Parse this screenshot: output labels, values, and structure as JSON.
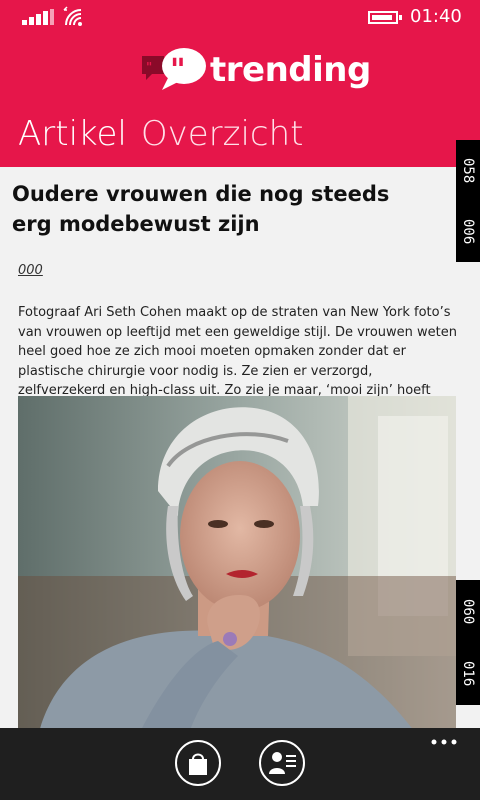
{
  "status": {
    "time": "01:40"
  },
  "header": {
    "logo_text": "trending",
    "tabs": [
      "Artikel",
      "Overzicht"
    ]
  },
  "article": {
    "title": "Oudere vrouwen die nog steeds erg modebewust zijn",
    "meta": "000",
    "body": "Fotograaf Ari Seth Cohen maakt op de straten van New York foto’s van vrouwen op leeftijd met een geweldige stijl. De vrouwen weten heel goed hoe ze zich mooi moeten opmaken zonder dat er plastische chirurgie voor nodig is. Ze zien er verzorgd, zelfverzekerd en high-class uit. Zo zie je maar, ‘mooi zijn’ hoeft niet te verouderen."
  },
  "side_rulers": {
    "top": [
      "058",
      "006"
    ],
    "bottom": [
      "060",
      "016"
    ]
  },
  "colors": {
    "accent": "#e6164a",
    "appbar": "#1f1f1f"
  },
  "icons": {
    "appbar": [
      "shopping-bag-icon",
      "profile-list-icon"
    ],
    "status": [
      "signal-icon",
      "wifi-icon",
      "battery-icon"
    ]
  }
}
